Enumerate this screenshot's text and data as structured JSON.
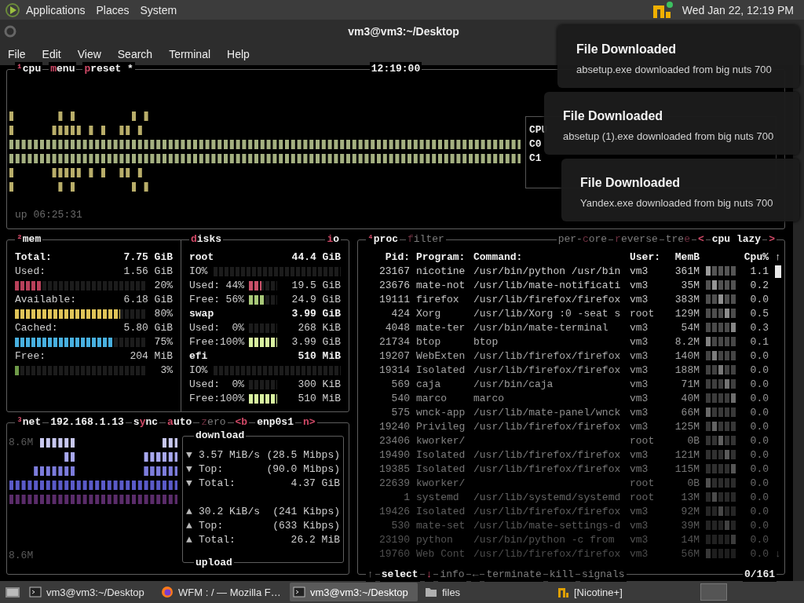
{
  "top_panel": {
    "menus": [
      "Applications",
      "Places",
      "System"
    ],
    "clock": "Wed Jan 22, 12:19 PM"
  },
  "window": {
    "title": "vm3@vm3:~/Desktop",
    "menu": [
      "File",
      "Edit",
      "View",
      "Search",
      "Terminal",
      "Help"
    ]
  },
  "cpu_box": {
    "tabs": [
      {
        "key": "¹",
        "post": "cpu"
      },
      {
        "key": "m",
        "post": "enu"
      },
      {
        "key": "p",
        "post": "reset *"
      }
    ],
    "clock": "12:19:00",
    "cores": [
      "CPU",
      "C0",
      "C1"
    ],
    "uptime": "up 06:25:31"
  },
  "mem_box": {
    "title": {
      "key": "²",
      "post": "mem"
    },
    "rows": [
      {
        "kind": "total",
        "label": "Total:",
        "value": "7.75 GiB"
      },
      {
        "kind": "value",
        "label": "Used:",
        "value": "1.56 GiB"
      },
      {
        "kind": "meter",
        "level": 0.2,
        "color": "#b8405a",
        "reading": "20%"
      },
      {
        "kind": "value",
        "label": "Available:",
        "value": "6.18 GiB"
      },
      {
        "kind": "meter",
        "level": 0.8,
        "color": "#e0c458",
        "reading": "80%"
      },
      {
        "kind": "value",
        "label": "Cached:",
        "value": "5.80 GiB"
      },
      {
        "kind": "meter",
        "level": 0.75,
        "color": "#48b0e0",
        "reading": "75%"
      },
      {
        "kind": "value",
        "label": "Free:",
        "value": "204 MiB"
      },
      {
        "kind": "meter",
        "level": 0.03,
        "color": "#6e9a48",
        "reading": "3%"
      }
    ]
  },
  "disks_box": {
    "title": {
      "key": "d",
      "post": "isks"
    },
    "io": {
      "key": "i",
      "post": "o"
    },
    "rows": [
      {
        "kind": "total",
        "label": "root",
        "value": "44.4 GiB"
      },
      {
        "kind": "io",
        "label": "IO%"
      },
      {
        "kind": "meter",
        "label": "Used:",
        "percent": "44%",
        "level": 0.44,
        "color": "#c85068",
        "value": "19.5 GiB"
      },
      {
        "kind": "meter",
        "label": "Free:",
        "percent": "56%",
        "level": 0.56,
        "color": "#a8c878",
        "value": "24.9 GiB"
      },
      {
        "kind": "total",
        "label": "swap",
        "value": "3.99 GiB"
      },
      {
        "kind": "meter",
        "label": "Used:",
        "percent": "0%",
        "value": "268 KiB"
      },
      {
        "kind": "meter",
        "label": "Free:",
        "percent": "100%",
        "level": 1,
        "color": "#d8f0a0",
        "value": "3.99 GiB"
      },
      {
        "kind": "total",
        "label": "efi",
        "value": "510 MiB"
      },
      {
        "kind": "io",
        "label": "IO%"
      },
      {
        "kind": "meter",
        "label": "Used:",
        "percent": "0%",
        "value": "300 KiB"
      },
      {
        "kind": "meter",
        "label": "Free:",
        "percent": "100%",
        "level": 1,
        "color": "#d8f0a0",
        "value": "510 MiB"
      }
    ]
  },
  "net_box": {
    "title": [
      {
        "key": "³",
        "post": "net",
        "disabled": false
      },
      {
        "text": "192.168.1.13",
        "disabled": false
      },
      {
        "pre": "s",
        "key": "y",
        "post": "nc",
        "disabled": false
      },
      {
        "key": "a",
        "post": "uto",
        "disabled": false
      },
      {
        "key": "z",
        "post": "ero",
        "disabled": true
      },
      {
        "key": "<b",
        "disabled": false
      },
      {
        "text": "enp0s1",
        "disabled": false
      },
      {
        "key": "n>",
        "disabled": false
      }
    ],
    "scale_top": "8.6M",
    "scale_bottom": "8.6M",
    "download": {
      "title": "download",
      "rows": [
        {
          "arrow": "▼",
          "label": "3.57 MiB/s",
          "value": "(28.5 Mibps)"
        },
        {
          "arrow": "▼",
          "label": "Top:",
          "value": "(90.0 Mibps)"
        },
        {
          "arrow": "▼",
          "label": "Total:",
          "value": "4.37 GiB"
        }
      ]
    },
    "upload": {
      "title": "upload",
      "rows": [
        {
          "arrow": "▲",
          "label": "30.2 KiB/s",
          "value": "(241 Kibps)"
        },
        {
          "arrow": "▲",
          "label": "Top:",
          "value": "(633 Kibps)"
        },
        {
          "arrow": "▲",
          "label": "Total:",
          "value": "26.2 MiB"
        }
      ]
    }
  },
  "proc_box": {
    "title": [
      {
        "key": "⁴",
        "post": "proc",
        "disabled": false
      },
      {
        "key": "f",
        "post": "ilter",
        "disabled": true
      }
    ],
    "options": [
      {
        "pre": "per-",
        "key": "c",
        "post": "ore",
        "disabled": true
      },
      {
        "key": "r",
        "post": "everse",
        "disabled": true
      },
      {
        "pre": "tre",
        "key": "e",
        "disabled": true
      },
      {
        "key": "<",
        "disabled": false
      },
      {
        "text": "cpu lazy",
        "disabled": false
      },
      {
        "key": ">",
        "disabled": false
      }
    ],
    "columns": [
      "Pid:",
      "Program:",
      "Command:",
      "User:",
      "MemB",
      "Cpu%"
    ],
    "scroll_up": "↑",
    "scroll_down": "↓",
    "rows": [
      [
        "23167",
        "nicotine",
        "/usr/bin/python /usr/bin",
        "vm3",
        "361M",
        "1.1"
      ],
      [
        "23676",
        "mate-not",
        "/usr/lib/mate-notificati",
        "vm3",
        "35M",
        "0.2"
      ],
      [
        "19111",
        "firefox",
        "/usr/lib/firefox/firefox",
        "vm3",
        "383M",
        "0.0"
      ],
      [
        "424",
        "Xorg",
        "/usr/lib/Xorg :0 -seat s",
        "root",
        "129M",
        "0.5"
      ],
      [
        "4048",
        "mate-ter",
        "/usr/bin/mate-terminal",
        "vm3",
        "54M",
        "0.3"
      ],
      [
        "21734",
        "btop",
        "btop",
        "vm3",
        "8.2M",
        "0.1"
      ],
      [
        "19207",
        "WebExten",
        "/usr/lib/firefox/firefox",
        "vm3",
        "140M",
        "0.0"
      ],
      [
        "19314",
        "Isolated",
        "/usr/lib/firefox/firefox",
        "vm3",
        "188M",
        "0.0"
      ],
      [
        "569",
        "caja",
        "/usr/bin/caja",
        "vm3",
        "71M",
        "0.0"
      ],
      [
        "540",
        "marco",
        "marco",
        "vm3",
        "40M",
        "0.0"
      ],
      [
        "575",
        "wnck-app",
        "/usr/lib/mate-panel/wnck",
        "vm3",
        "66M",
        "0.0"
      ],
      [
        "19240",
        "Privileg",
        "/usr/lib/firefox/firefox",
        "vm3",
        "125M",
        "0.0"
      ],
      [
        "23406",
        "kworker/",
        "",
        "root",
        "0B",
        "0.0"
      ],
      [
        "19490",
        "Isolated",
        "/usr/lib/firefox/firefox",
        "vm3",
        "121M",
        "0.0"
      ],
      [
        "19385",
        "Isolated",
        "/usr/lib/firefox/firefox",
        "vm3",
        "115M",
        "0.0"
      ],
      [
        "22639",
        "kworker/",
        "",
        "root",
        "0B",
        "0.0"
      ],
      [
        "1",
        "systemd",
        "/usr/lib/systemd/systemd",
        "root",
        "13M",
        "0.0"
      ],
      [
        "19426",
        "Isolated",
        "/usr/lib/firefox/firefox",
        "vm3",
        "92M",
        "0.0"
      ],
      [
        "530",
        "mate-set",
        "/usr/lib/mate-settings-d",
        "vm3",
        "39M",
        "0.0"
      ],
      [
        "23190",
        "python",
        "/usr/bin/python -c from",
        "vm3",
        "14M",
        "0.0"
      ],
      [
        "19760",
        "Web Cont",
        "/usr/lib/firefox/firefox",
        "vm3",
        "56M",
        "0.0"
      ]
    ],
    "footer": [
      {
        "text": "↑",
        "disabled": true
      },
      {
        "text": "select",
        "disabled": false
      },
      {
        "key": "↓",
        "disabled": false
      },
      {
        "text": "info",
        "disabled": true
      },
      {
        "text": "←",
        "disabled": true
      },
      {
        "text": "terminate",
        "disabled": true
      },
      {
        "text": "kill",
        "disabled": true
      },
      {
        "text": "signals",
        "disabled": true
      }
    ],
    "count": "0/161"
  },
  "notifications": [
    {
      "title": "File Downloaded",
      "body": "absetup.exe downloaded from big nuts 700"
    },
    {
      "title": "File Downloaded",
      "body": "absetup (1).exe downloaded from big nuts 700"
    },
    {
      "title": "File Downloaded",
      "body": "Yandex.exe downloaded from big nuts 700"
    }
  ],
  "taskbar": [
    {
      "kind": "terminal",
      "label": "vm3@vm3:~/Desktop",
      "selected": false
    },
    {
      "kind": "browser",
      "label": "WFM : / — Mozilla F…",
      "selected": false
    },
    {
      "kind": "terminal",
      "label": "vm3@vm3:~/Desktop",
      "selected": true
    },
    {
      "kind": "folder",
      "label": "files",
      "selected": false
    },
    {
      "kind": "nicotine",
      "label": "[Nicotine+]",
      "selected": false
    }
  ]
}
